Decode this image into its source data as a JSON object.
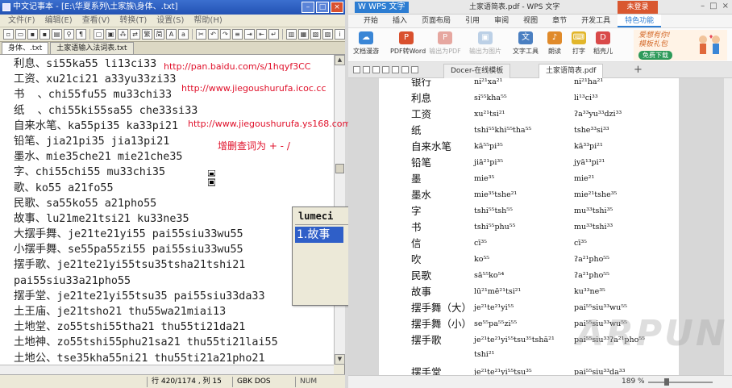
{
  "editor": {
    "title": "中文记事本 - [E:\\华夏系列\\土家族\\身体、.txt]",
    "menu": [
      "文件(F)",
      "编辑(E)",
      "查看(V)",
      "转换(T)",
      "设置(S)",
      "帮助(H)"
    ],
    "tabs": [
      "身体、.txt",
      "土家语输入法词表.txt"
    ],
    "lines": [
      "利息、si55ka55 li13ci33",
      "工资、xu21ci21 a33yu33zi33",
      "书  、chi55fu55 mu33chi33",
      "纸  、chi55ki55sa55 che33si33",
      "自来水笔、ka55pi35 ka33pi21",
      "铅笔、jia21pi35 jia13pi21",
      "墨水、mie35che21 mie21che35",
      "字、chi55chi55 mu33chi35",
      "歌、ko55 a21fo55",
      "民歌、sa55ko55 a21pho55",
      "故事、lu21me21tsi21 ku33ne35",
      "大摆手舞、je21te21yi55 pai55siu33wu55",
      "小摆手舞、se55pa55zi55 pai55siu33wu55",
      "摆手歌、je21te21yi55tsu35tsha21tshi21",
      "pai55siu33a21pho55",
      "摆手堂、je21te21yi55tsu35 pai55siu33da33",
      "土王庙、je21tsho21 thu55wa21miai13",
      "土地堂、zo55tshi55tha21 thu55ti21da21",
      "土地神、zo55tshi55phu21sa21 thu55ti21lai55",
      "土地公、tse35kha55ni21 thu55ti21a21pho21"
    ],
    "status": {
      "position": "行 420/1174 , 列 15",
      "encoding": "GBK  DOS",
      "num": "NUM"
    }
  },
  "annotations": {
    "link1": "http://pan.baidu.com/s/1hqyf3CC",
    "link2": "http://www.jiegoushurufa.icoc.cc",
    "link3": "http://www.jiegoushurufa.ys168.com",
    "hint": "增删查词为 + - /"
  },
  "ime": {
    "input": "lumeci",
    "candidate": "1.故事"
  },
  "wps": {
    "logo": "W WPS 文字",
    "doc_title": "土家语简表.pdf - WPS 文字",
    "login": "未登录",
    "ribbon_tabs": [
      "开始",
      "插入",
      "页面布局",
      "引用",
      "审阅",
      "视图",
      "章节",
      "开发工具",
      "特色功能"
    ],
    "tools": {
      "scan": "文档漫游",
      "pdf2word": "PDF转Word",
      "export_pdf": "输出为PDF",
      "export_img": "输出为图片",
      "text_tool": "文字工具",
      "read": "朗读",
      "typing": "打字",
      "template": "稻壳儿"
    },
    "promo": {
      "line1": "爱想有你!",
      "line2": "模板礼包",
      "button": "免费下载"
    },
    "doc_tabs": [
      "Docer-在线模板",
      "土家语简表.pdf"
    ],
    "rows": [
      {
        "cn": "银行",
        "a": "ni²¹xa²¹",
        "b": "ni²¹ha²¹"
      },
      {
        "cn": "利息",
        "a": "si⁵⁵kha⁵⁵",
        "b": "li¹³ci³³"
      },
      {
        "cn": "工资",
        "a": "xu²¹tsi²¹",
        "b": "ʔa³³yu³³dzi³³"
      },
      {
        "cn": "纸",
        "a": "tshi⁵⁵khi⁵⁵tha⁵⁵",
        "b": "tshe³³si³³"
      },
      {
        "cn": "自来水笔",
        "a": "kā⁵⁵pi³⁵",
        "b": "kā³³pi²¹"
      },
      {
        "cn": "铅笔",
        "a": "jiā²¹pi³⁵",
        "b": "jyā¹³pi²¹"
      },
      {
        "cn": "墨",
        "a": "mie³⁵",
        "b": "mie²¹"
      },
      {
        "cn": "墨水",
        "a": "mie³⁵tshe²¹",
        "b": "mie²¹tshe³⁵"
      },
      {
        "cn": "字",
        "a": "tshi⁵⁵tsh⁵⁵",
        "b": "mu³³tshi³⁵"
      },
      {
        "cn": "书",
        "a": "tshi⁵⁵phu⁵⁵",
        "b": "mu³³tshi³³"
      },
      {
        "cn": "信",
        "a": "cī³⁵",
        "b": "cī³⁵"
      },
      {
        "cn": "吹",
        "a": "ko⁵⁵",
        "b": "ʔa²¹pho⁵⁵"
      },
      {
        "cn": "民歌",
        "a": "sā⁵⁵ko⁵⁴",
        "b": "ʔa²¹pho⁵⁵"
      },
      {
        "cn": "故事",
        "a": "lū²¹mē²¹tsi²¹",
        "b": "ku³³ne³⁵"
      },
      {
        "cn": "摆手舞（大）",
        "a": "je²¹te²¹yi⁵⁵",
        "b": "pai⁵⁵siu³³wu⁵⁵"
      },
      {
        "cn": "摆手舞（小）",
        "a": "se⁵⁵pa⁵⁵zi⁵⁵",
        "b": "pai⁵⁵siu³³wu⁵⁵"
      },
      {
        "cn": "摆手歌",
        "a": "je²¹te²¹yi⁵⁵tsu³⁵tshā²¹",
        "b": "pai⁵⁵siu³³ʔa²¹pho⁵⁵"
      },
      {
        "cn": "",
        "a": "tshi²¹",
        "b": ""
      },
      {
        "cn": "摆手堂",
        "a": "je²¹te²¹yi⁵⁵tsu³⁵",
        "b": "pai⁵⁵siu³³da³³"
      }
    ],
    "zoom": "189 %",
    "watermark": "ARPUN"
  }
}
